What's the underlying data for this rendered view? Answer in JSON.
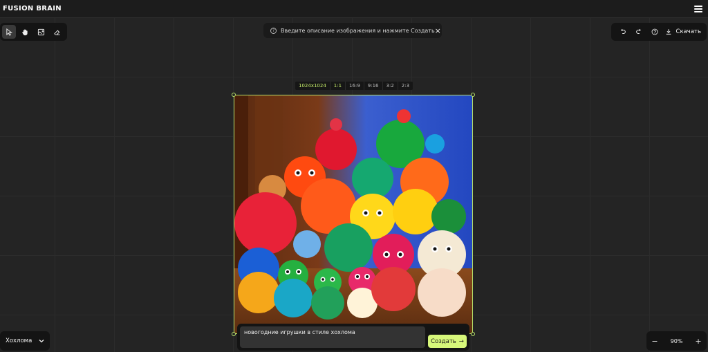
{
  "app": {
    "logo": "FUSION BRAIN"
  },
  "toolbar": {
    "tools": [
      "cursor",
      "hand",
      "add-image",
      "eraser"
    ],
    "active_tool": "cursor"
  },
  "hint": {
    "text": "Введите описание изображения и нажмите Создать",
    "close": "×",
    "info": "?"
  },
  "actions": {
    "download_label": "Скачать"
  },
  "ratios": {
    "size": "1024x1024",
    "options": [
      "1:1",
      "16:9",
      "9:16",
      "3:2",
      "2:3"
    ],
    "selected": "1:1"
  },
  "prompt": {
    "value": "новогодние игрушки в стиле хохлома",
    "create_label": "Создать",
    "create_arrow": "→"
  },
  "style": {
    "selected": "Хохлома"
  },
  "zoom": {
    "value": "90%",
    "minus": "−",
    "plus": "+"
  },
  "colors": {
    "accent": "#d7f77a",
    "frame": "#b7e36b",
    "background": "#242424"
  }
}
